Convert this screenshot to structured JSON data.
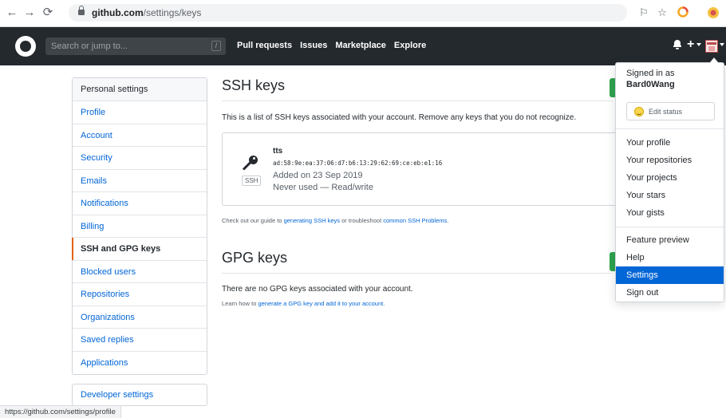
{
  "browser": {
    "url_host": "github.com",
    "url_path": "/settings/keys",
    "status_url": "https://github.com/settings/profile"
  },
  "header": {
    "search_placeholder": "Search or jump to...",
    "slash_hint": "/",
    "nav": [
      "Pull requests",
      "Issues",
      "Marketplace",
      "Explore"
    ]
  },
  "sidebar": {
    "heading": "Personal settings",
    "items": [
      {
        "label": "Profile"
      },
      {
        "label": "Account"
      },
      {
        "label": "Security"
      },
      {
        "label": "Emails"
      },
      {
        "label": "Notifications"
      },
      {
        "label": "Billing"
      },
      {
        "label": "SSH and GPG keys",
        "active": true
      },
      {
        "label": "Blocked users"
      },
      {
        "label": "Repositories"
      },
      {
        "label": "Organizations"
      },
      {
        "label": "Saved replies"
      },
      {
        "label": "Applications"
      }
    ],
    "developer_settings": "Developer settings"
  },
  "ssh": {
    "title": "SSH keys",
    "description": "This is a list of SSH keys associated with your account. Remove any keys that you do not recognize.",
    "key": {
      "badge": "SSH",
      "title": "tts",
      "fingerprint": "ad:58:9e:ea:37:06:d7:b6:13:29:62:69:ce:eb:e1:16",
      "added": "Added on 23 Sep 2019",
      "usage": "Never used — Read/write"
    },
    "guide_prefix": "Check out our guide to ",
    "guide_link1": "generating SSH keys",
    "guide_mid": " or troubleshoot ",
    "guide_link2": "common SSH Problems",
    "guide_suffix": "."
  },
  "gpg": {
    "title": "GPG keys",
    "none_text": "There are no GPG keys associated with your account.",
    "learn_prefix": "Learn how to ",
    "learn_link": "generate a GPG key and add it to your account",
    "learn_suffix": "."
  },
  "dropdown": {
    "signed_in_as": "Signed in as",
    "username": "Bard0Wang",
    "edit_status": "Edit status",
    "group1": [
      "Your profile",
      "Your repositories",
      "Your projects",
      "Your stars",
      "Your gists"
    ],
    "group2": [
      "Feature preview",
      "Help",
      "Settings",
      "Sign out"
    ],
    "highlighted": "Settings"
  },
  "colors": {
    "header_bg": "#24292e",
    "link": "#0366d6",
    "active_border": "#e36209",
    "primary_button": "#2ea44f",
    "highlight": "#0366d6"
  },
  "icons": [
    "back-arrow-icon",
    "forward-arrow-icon",
    "reload-icon",
    "lock-icon",
    "translate-icon",
    "star-icon",
    "extension-icon",
    "profile-icon",
    "github-logo-icon",
    "bell-icon",
    "plus-icon",
    "caret-down-icon",
    "key-icon",
    "smiley-icon"
  ]
}
